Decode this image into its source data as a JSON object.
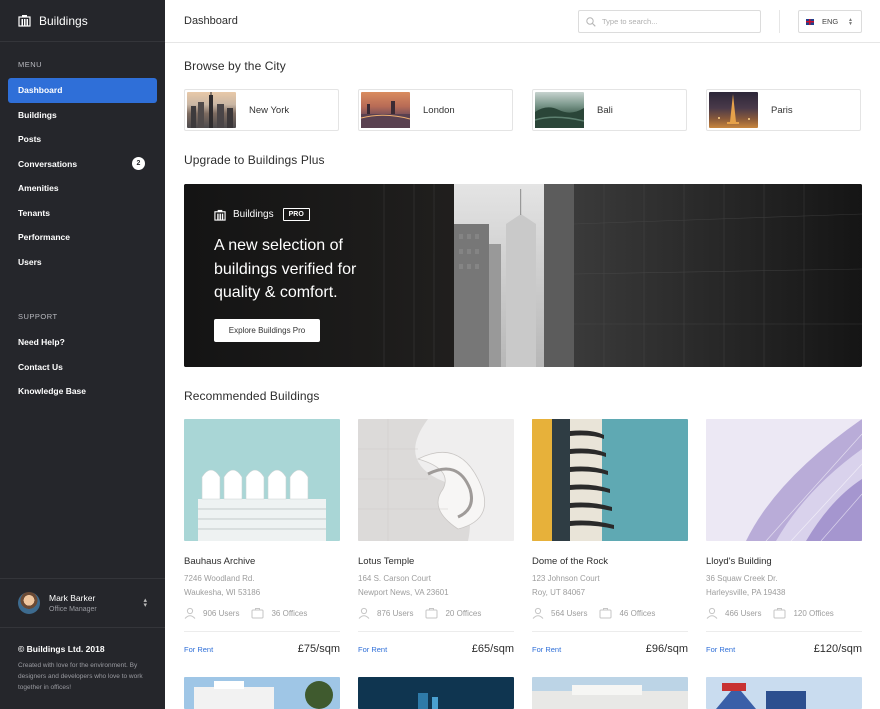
{
  "brand": {
    "name": "Buildings"
  },
  "sidebar": {
    "menu_label": "MENU",
    "menu_items": [
      {
        "label": "Dashboard",
        "active": true
      },
      {
        "label": "Buildings"
      },
      {
        "label": "Posts"
      },
      {
        "label": "Conversations",
        "badge": "2"
      },
      {
        "label": "Amenities"
      },
      {
        "label": "Tenants"
      },
      {
        "label": "Performance"
      },
      {
        "label": "Users"
      }
    ],
    "support_label": "SUPPORT",
    "support_items": [
      {
        "label": "Need Help?"
      },
      {
        "label": "Contact Us"
      },
      {
        "label": "Knowledge Base"
      }
    ],
    "user": {
      "name": "Mark Barker",
      "role": "Office Manager"
    },
    "footer": {
      "copyright": "© Buildings Ltd. 2018",
      "text": "Created with love for the environment. By designers and developers who love to work together in offices!"
    }
  },
  "topbar": {
    "title": "Dashboard",
    "search_placeholder": "Type to search...",
    "language": "ENG"
  },
  "cities": {
    "title": "Browse by the City",
    "items": [
      {
        "name": "New York"
      },
      {
        "name": "London"
      },
      {
        "name": "Bali"
      },
      {
        "name": "Paris"
      }
    ]
  },
  "upgrade": {
    "title": "Upgrade to Buildings Plus",
    "brand": "Buildings",
    "badge": "PRO",
    "headline": "A new selection of buildings verified for quality & comfort.",
    "button": "Explore Buildings Pro"
  },
  "recommended": {
    "title": "Recommended Buildings",
    "items": [
      {
        "name": "Bauhaus Archive",
        "addr1": "7246 Woodland Rd.",
        "addr2": "Waukesha, WI 53186",
        "users": "906 Users",
        "offices": "36 Offices",
        "status": "For Rent",
        "price": "£75/sqm"
      },
      {
        "name": "Lotus Temple",
        "addr1": "164 S. Carson Court",
        "addr2": "Newport News, VA 23601",
        "users": "876 Users",
        "offices": "20 Offices",
        "status": "For Rent",
        "price": "£65/sqm"
      },
      {
        "name": "Dome of the Rock",
        "addr1": "123 Johnson Court",
        "addr2": "Roy, UT 84067",
        "users": "564 Users",
        "offices": "46 Offices",
        "status": "For Rent",
        "price": "£96/sqm"
      },
      {
        "name": "Lloyd's Building",
        "addr1": "36 Squaw Creek Dr.",
        "addr2": "Harleysville, PA 19438",
        "users": "466 Users",
        "offices": "120 Offices",
        "status": "For Rent",
        "price": "£120/sqm"
      }
    ]
  },
  "colors": {
    "sidebar_bg": "#25262b",
    "accent": "#2f6fd8"
  }
}
